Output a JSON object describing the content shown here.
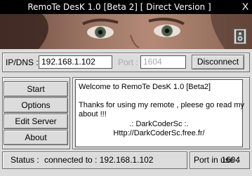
{
  "window": {
    "title": "RemoTe DesK 1.0 [Beta 2] [ Direct Version ]",
    "close_label": "X"
  },
  "connection": {
    "ip_label": "IP/DNS :",
    "ip_value": "192.168.1.102",
    "port_label": "Port :",
    "port_value": "1604",
    "disconnect_label": "Disconnect"
  },
  "menu": {
    "items": [
      "Start",
      "Options",
      "Edit Server",
      "About"
    ]
  },
  "message": {
    "line1": "Welcome to RemoTe DesK 1.0 [Beta2]",
    "line2": "Thanks for using my remote , pleese go read my",
    "line3": "about !!!",
    "line4": ".: DarkCoderSc :.",
    "line5": "Http://DarkCoderSc.free.fr/"
  },
  "status": {
    "status_label": "Status :",
    "status_value": "connected to : 192.168.1.102",
    "port_in_use_label": "Port in use :",
    "port_in_use_value": "1604"
  },
  "colors": {
    "titlebar": "#000000",
    "window_bg": "#dcdcdc",
    "field_bg": "#ffffff",
    "disabled_text": "#a8a8a8"
  },
  "icons": {
    "speaker": "speaker-icon",
    "close": "close-icon"
  }
}
